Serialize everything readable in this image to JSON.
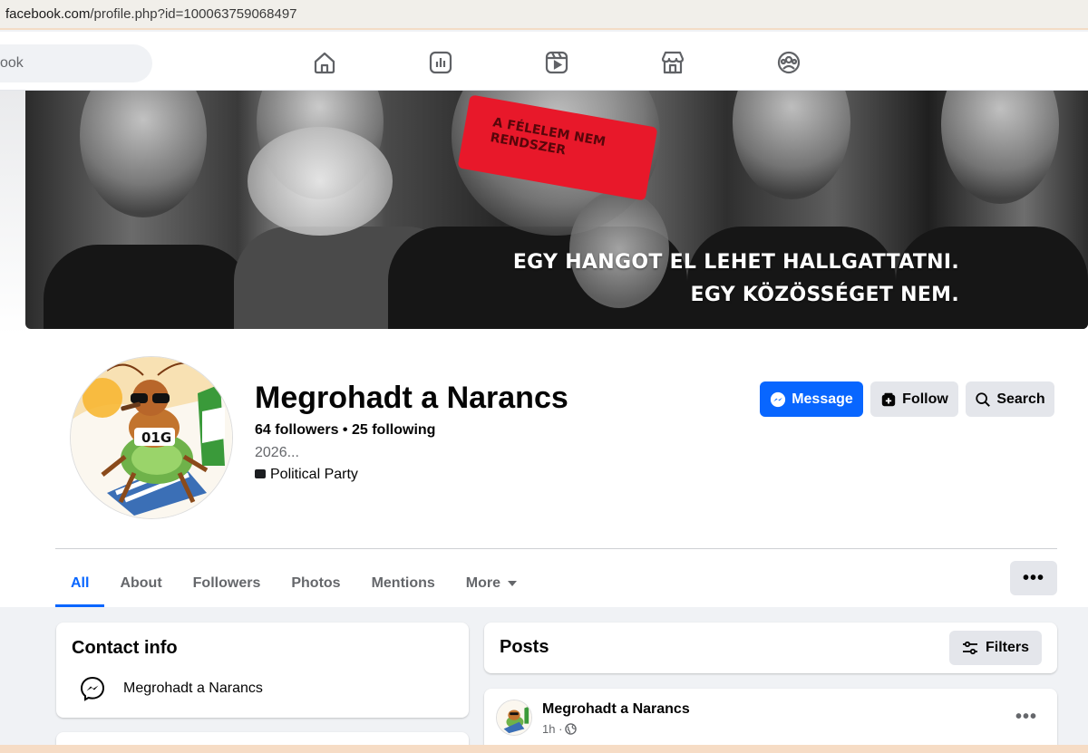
{
  "browser": {
    "url_host": "facebook.com",
    "url_path": "/profile.php?id=100063759068497"
  },
  "topnav": {
    "search_placeholder": "ook",
    "icons": [
      "home-icon",
      "pages-icon",
      "video-icon",
      "marketplace-icon",
      "groups-icon"
    ]
  },
  "cover": {
    "tape_text": "A FÉLELEM NEM\nRENDSZER",
    "slogan_line1": "EGY HANGOT EL LEHET HALLGATTATNI.",
    "slogan_line2": "EGY KÖZÖSSÉGET NEM."
  },
  "profile": {
    "name": "Megrohadt a Narancs",
    "followers": "64 followers",
    "separator": " • ",
    "following": "25 following",
    "bio": "2026...",
    "category": "Political Party",
    "avatar_text": "01G"
  },
  "actions": {
    "message": "Message",
    "follow": "Follow",
    "search": "Search"
  },
  "tabs": [
    {
      "label": "All",
      "active": true
    },
    {
      "label": "About"
    },
    {
      "label": "Followers"
    },
    {
      "label": "Photos"
    },
    {
      "label": "Mentions"
    },
    {
      "label": "More"
    }
  ],
  "more_options": "•••",
  "contact_info": {
    "title": "Contact info",
    "messenger_name": "Megrohadt a Narancs"
  },
  "posts": {
    "title": "Posts",
    "filters_label": "Filters",
    "first_post": {
      "author": "Megrohadt a Narancs",
      "time": "1h ·",
      "options": "•••"
    }
  },
  "colors": {
    "primary": "#0866ff",
    "grey_button": "#e4e6eb",
    "page_bg": "#f0f2f5",
    "tape_red": "#e8182a"
  }
}
